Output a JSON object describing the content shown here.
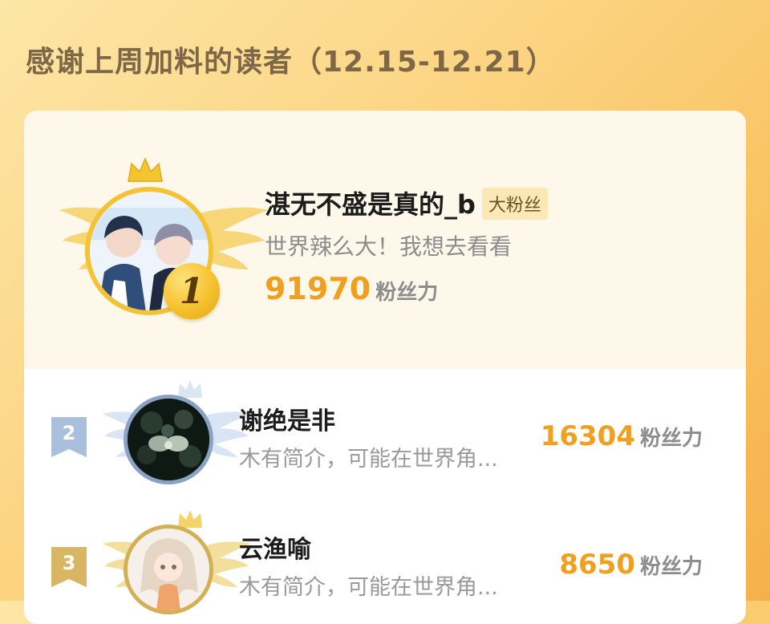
{
  "header": {
    "title": "感谢上周加料的读者（12.15-12.21）"
  },
  "colors": {
    "accent": "#f0a01e",
    "gold": "#f6c12e",
    "silver": "#a9bfdc",
    "bronze": "#d9b664"
  },
  "first_place": {
    "rank": "1",
    "name": "湛无不盛是真的_b",
    "badge": "大粉丝",
    "bio": "世界辣么大！我想去看看",
    "score": "91970",
    "score_unit": "粉丝力"
  },
  "ranking": [
    {
      "rank": "2",
      "name": "谢绝是非",
      "bio": "木有简介，可能在世界角...",
      "score": "16304",
      "score_unit": "粉丝力"
    },
    {
      "rank": "3",
      "name": "云渔喻",
      "bio": "木有简介，可能在世界角...",
      "score": "8650",
      "score_unit": "粉丝力"
    }
  ],
  "icons": [
    "crown-icon",
    "laurel-wing-icon",
    "rank-medal-icon",
    "rank-ribbon-icon"
  ]
}
